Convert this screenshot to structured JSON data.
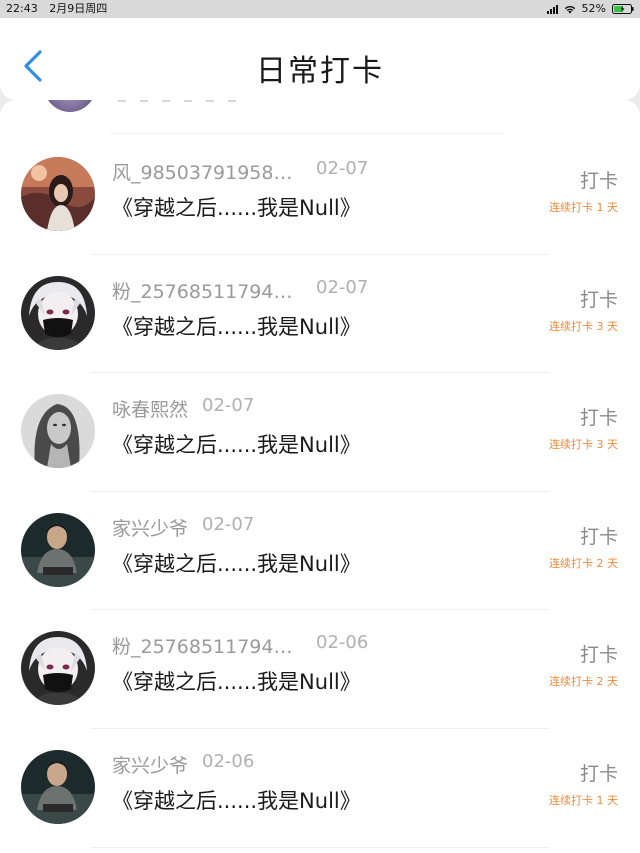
{
  "status_bar": {
    "time": "22:43",
    "date": "2月9日周四",
    "battery": "52%"
  },
  "header": {
    "title": "日常打卡",
    "back_icon": "chevron-left-icon"
  },
  "checkins": [
    {
      "user": "风_985037919588...",
      "date": "02-07",
      "book": "《穿越之后......我是Null》",
      "action": "打卡",
      "streak": "连续打卡 1 天",
      "avatar": "avatar-girl-sunset"
    },
    {
      "user": "粉_257685117942...",
      "date": "02-07",
      "book": "《穿越之后......我是Null》",
      "action": "打卡",
      "streak": "连续打卡 3 天",
      "avatar": "avatar-anime-mask"
    },
    {
      "user": "咏春熙然",
      "date": "02-07",
      "book": "《穿越之后......我是Null》",
      "action": "打卡",
      "streak": "连续打卡 3 天",
      "avatar": "avatar-woman-bw"
    },
    {
      "user": "家兴少爷",
      "date": "02-07",
      "book": "《穿越之后......我是Null》",
      "action": "打卡",
      "streak": "连续打卡 2 天",
      "avatar": "avatar-man-sitting"
    },
    {
      "user": "粉_257685117942...",
      "date": "02-06",
      "book": "《穿越之后......我是Null》",
      "action": "打卡",
      "streak": "连续打卡 2 天",
      "avatar": "avatar-anime-mask"
    },
    {
      "user": "家兴少爷",
      "date": "02-06",
      "book": "《穿越之后......我是Null》",
      "action": "打卡",
      "streak": "连续打卡 1 天",
      "avatar": "avatar-man-sitting"
    }
  ],
  "colors": {
    "accent_blue": "#2f8fe6",
    "streak_orange": "#f0893a",
    "muted_text": "#9a9a9a"
  }
}
